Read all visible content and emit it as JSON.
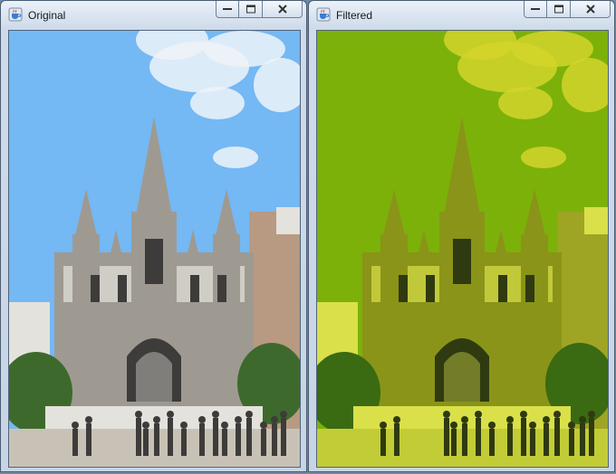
{
  "windows": [
    {
      "title": "Original",
      "icon": "java-cup-icon",
      "controls": [
        "minimize-icon",
        "maximize-icon",
        "close-icon"
      ],
      "palette": {
        "sky": "#74b8f4",
        "cloud": "#eef3f8",
        "stone": "#9e9a92",
        "stone_light": "#e4e2dc",
        "shadow": "#3e3c3a",
        "tree": "#3d6a2c",
        "ground": "#c8c2b6",
        "building": "#b89a82"
      }
    },
    {
      "title": "Filtered",
      "icon": "java-cup-icon",
      "controls": [
        "minimize-icon",
        "maximize-icon",
        "close-icon"
      ],
      "palette": {
        "sky": "#7cb10a",
        "cloud": "#d4d52a",
        "stone": "#8a9418",
        "stone_light": "#d9e04a",
        "shadow": "#2f3a10",
        "tree": "#3a6a12",
        "ground": "#c2cc36",
        "building": "#9ea424"
      }
    }
  ]
}
